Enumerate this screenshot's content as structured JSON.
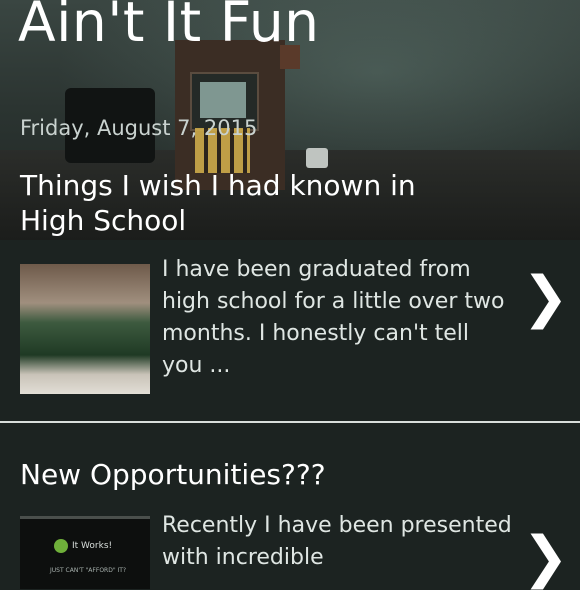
{
  "blog": {
    "title": "Ain't It Fun"
  },
  "post1": {
    "date": "Friday, August 7, 2015",
    "title": "Things I wish I had known in High School",
    "snippet": "I have been graduated from high school for a little over two months.  I honestly can't tell you ...",
    "chevron": "❯"
  },
  "post2": {
    "title": "New Opportunities???",
    "snippet": "Recently I have been presented with incredible",
    "chevron": "❯",
    "thumb_text": "It Works!",
    "thumb_subtext": "JUST CAN'T \"AFFORD\" IT?"
  },
  "colors": {
    "background": "#1c2321",
    "divider": "#d8dedb",
    "text": "#f2f4f3",
    "date": "#c9d2cf"
  }
}
